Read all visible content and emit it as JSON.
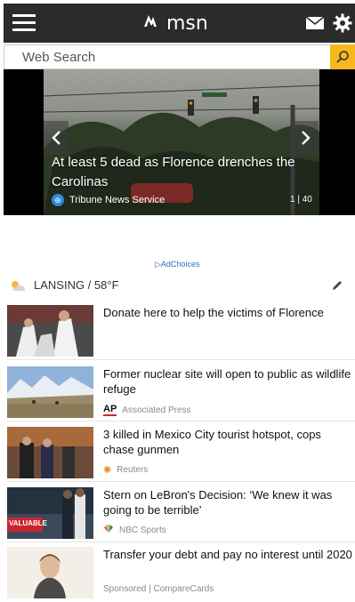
{
  "header": {
    "logo_text": "msn",
    "icons": [
      "hamburger-menu-icon",
      "msn-logo-icon",
      "mail-icon",
      "gear-icon"
    ]
  },
  "search": {
    "placeholder": "Web Search",
    "value": ""
  },
  "hero": {
    "headline": "At least 5 dead as Florence drenches the Carolinas",
    "source": "Tribune News Service",
    "counter": "1 | 40"
  },
  "ad": {
    "adchoices_label": "AdChoices"
  },
  "weather": {
    "location_temp": "LANSING / 58°F",
    "icon": "partly-cloudy-icon"
  },
  "feed": [
    {
      "title": "Donate here to help the victims of Florence",
      "source": ""
    },
    {
      "title": "Former nuclear site will open to public as wildlife refuge",
      "source": "Associated Press",
      "source_logo": "AP"
    },
    {
      "title": "3 killed in Mexico City tourist hotspot, cops chase gunmen",
      "source": "Reuters"
    },
    {
      "title": "Stern on LeBron's Decision: ‘We knew it was going to be terrible’",
      "source": "NBC Sports",
      "thumb_caption": "VALUABLE"
    },
    {
      "title": "Transfer your debt and pay no interest until 2020",
      "source": "Sponsored | CompareCards"
    }
  ],
  "colors": {
    "topbar": "#2b2b2b",
    "search_button": "#f6b81b",
    "link_blue": "#2f6fb5",
    "ap_red": "#d7242f"
  }
}
